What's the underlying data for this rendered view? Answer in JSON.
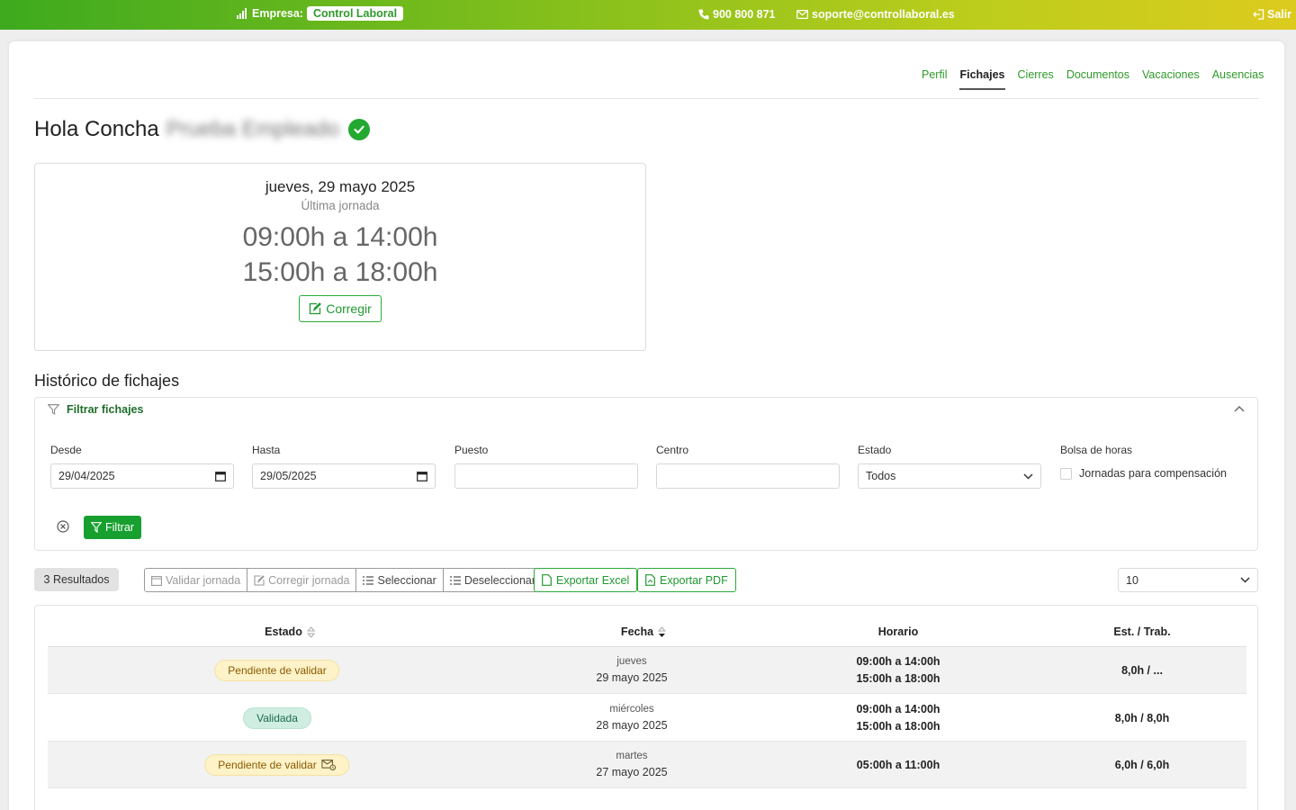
{
  "topbar": {
    "company_label": "Empresa:",
    "company_name": "Control Laboral",
    "phone": "900 800 871",
    "email": "soporte@controllaboral.es",
    "logout": "Salir"
  },
  "nav": {
    "items": [
      "Perfil",
      "Fichajes",
      "Cierres",
      "Documentos",
      "Vacaciones",
      "Ausencias"
    ],
    "active": "Fichajes"
  },
  "greeting": {
    "prefix": "Hola Concha",
    "blurred_name": "Prueba Empleado"
  },
  "last_day": {
    "date": "jueves, 29 mayo 2025",
    "subtitle": "Última jornada",
    "ranges": [
      "09:00h a 14:00h",
      "15:00h a 18:00h"
    ],
    "correct_button": "Corregir"
  },
  "history": {
    "title": "Histórico de fichajes",
    "filter_title": "Filtrar fichajes",
    "fields": {
      "desde_label": "Desde",
      "desde_value": "29/04/2025",
      "hasta_label": "Hasta",
      "hasta_value": "29/05/2025",
      "puesto_label": "Puesto",
      "puesto_value": "",
      "centro_label": "Centro",
      "centro_value": "",
      "estado_label": "Estado",
      "estado_value": "Todos",
      "bolsa_label": "Bolsa de horas",
      "bolsa_checkbox": "Jornadas para compensación"
    },
    "filter_button": "Filtrar"
  },
  "toolbar": {
    "results": "3 Resultados",
    "validar": "Validar jornada",
    "corregir": "Corregir jornada",
    "seleccionar": "Seleccionar",
    "deseleccionar": "Deseleccionar",
    "export_excel": "Exportar Excel",
    "export_pdf": "Exportar PDF",
    "page_size": "10"
  },
  "table": {
    "headers": {
      "estado": "Estado",
      "fecha": "Fecha",
      "horario": "Horario",
      "est_trab": "Est. / Trab."
    },
    "rows": [
      {
        "estado": "Pendiente de validar",
        "weekday": "jueves",
        "date": "29 mayo 2025",
        "horario1": "09:00h a 14:00h",
        "horario2": "15:00h a 18:00h",
        "est_trab": "8,0h / ..."
      },
      {
        "estado": "Validada",
        "weekday": "miércoles",
        "date": "28 mayo 2025",
        "horario1": "09:00h a 14:00h",
        "horario2": "15:00h a 18:00h",
        "est_trab": "8,0h / 8,0h"
      },
      {
        "estado": "Pendiente de validar",
        "weekday": "martes",
        "date": "27 mayo 2025",
        "horario1": "05:00h a 11:00h",
        "horario2": "",
        "est_trab": "6,0h / 6,0h"
      }
    ]
  },
  "colors": {
    "brand_green": "#17a02f",
    "gradient_start": "#3eaa1e",
    "gradient_end": "#dccb1e",
    "pending_bg": "#fdf2c8",
    "valid_bg": "#cfeee1"
  }
}
